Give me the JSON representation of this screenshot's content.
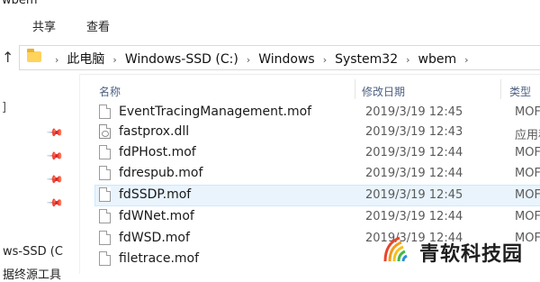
{
  "window": {
    "title_fragment": "wbem"
  },
  "ribbon": {
    "tabs": [
      "共享",
      "查看"
    ]
  },
  "address": {
    "crumbs": [
      "此电脑",
      "Windows-SSD (C:)",
      "Windows",
      "System32",
      "wbem"
    ],
    "up_icon": "up-arrow-icon",
    "folder_icon": "folder-icon"
  },
  "nav": {
    "mark": "]",
    "drive_label": "ws-SSD (C",
    "bottom_label": "据终源工具"
  },
  "columns": {
    "name": "名称",
    "date": "修改日期",
    "type": "类型"
  },
  "files": [
    {
      "name": "EventTracingManagement.mof",
      "date": "2019/3/19 12:45",
      "type": "MOF",
      "icon": "file-icon"
    },
    {
      "name": "fastprox.dll",
      "date": "2019/3/19 12:43",
      "type": "应用程",
      "icon": "dll-file-icon"
    },
    {
      "name": "fdPHost.mof",
      "date": "2019/3/19 12:44",
      "type": "MOF",
      "icon": "file-icon"
    },
    {
      "name": "fdrespub.mof",
      "date": "2019/3/19 12:44",
      "type": "MOF",
      "icon": "file-icon"
    },
    {
      "name": "fdSSDP.mof",
      "date": "2019/3/19 12:45",
      "type": "MOF",
      "icon": "file-icon",
      "selected": true
    },
    {
      "name": "fdWNet.mof",
      "date": "2019/3/19 12:44",
      "type": "MOF",
      "icon": "file-icon"
    },
    {
      "name": "fdWSD.mof",
      "date": "2019/3/19 12:44",
      "type": "MOF",
      "icon": "file-icon"
    },
    {
      "name": "filetrace.mof",
      "date": "",
      "type": "",
      "icon": "file-icon"
    }
  ],
  "watermark": {
    "text": "青软科技园"
  },
  "colors": {
    "accent": "#1979ca",
    "selection": "#e9f4fd",
    "folder": "#ffd35c"
  }
}
